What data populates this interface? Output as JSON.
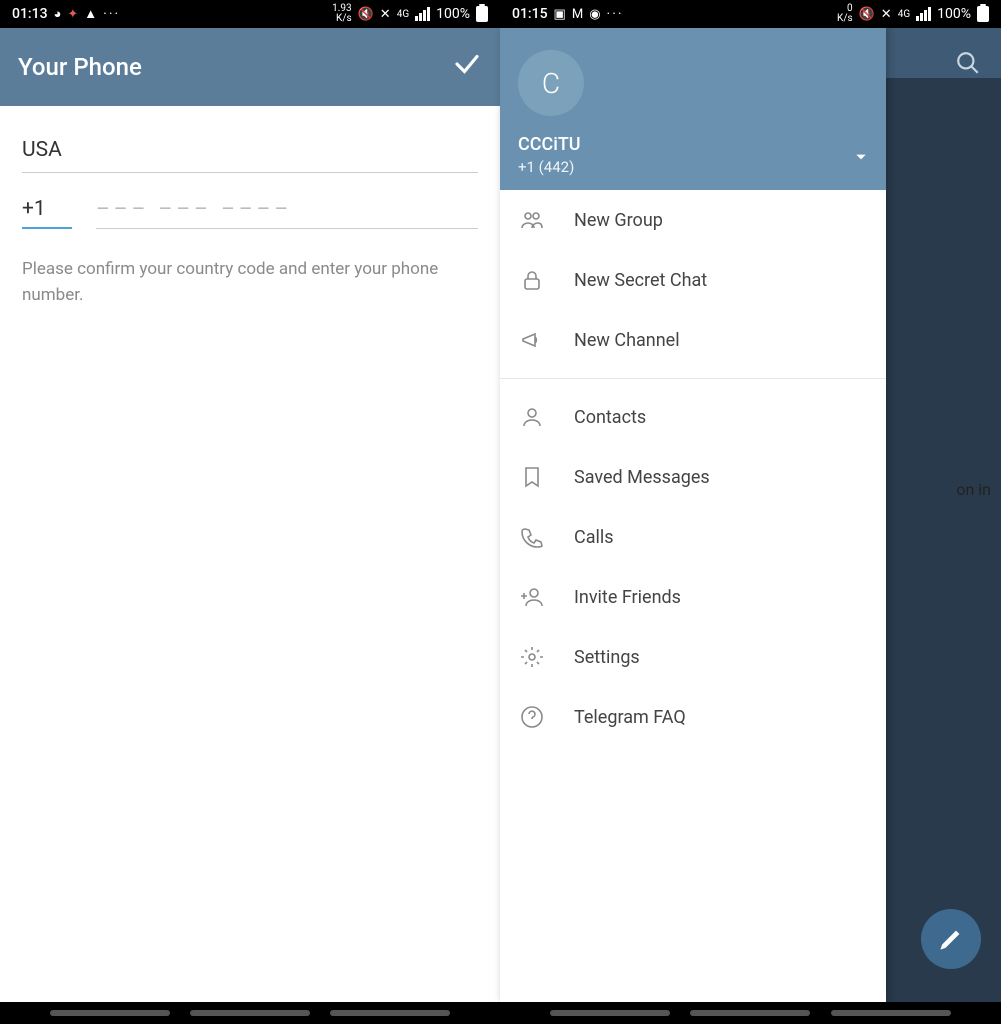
{
  "left": {
    "status": {
      "time": "01:13",
      "kbs": "1.93\nK/s",
      "net": "4G",
      "battery": "100%"
    },
    "header": {
      "title": "Your Phone"
    },
    "login": {
      "country": "USA",
      "code": "+1",
      "placeholder": "––– ––– ––––",
      "help": "Please confirm your country code and enter your phone number."
    }
  },
  "right": {
    "status": {
      "time": "01:15",
      "kbs": "0\nK/s",
      "net": "4G",
      "battery": "100%"
    },
    "bg_fragment": "on in",
    "drawer": {
      "avatar_initial": "C",
      "user_name": "CCCiTU",
      "user_phone": "+1 (442)",
      "menu_a": [
        {
          "key": "new-group",
          "label": "New Group"
        },
        {
          "key": "new-secret",
          "label": "New Secret Chat"
        },
        {
          "key": "new-channel",
          "label": "New Channel"
        }
      ],
      "menu_b": [
        {
          "key": "contacts",
          "label": "Contacts"
        },
        {
          "key": "saved",
          "label": "Saved Messages"
        },
        {
          "key": "calls",
          "label": "Calls"
        },
        {
          "key": "invite",
          "label": "Invite Friends"
        },
        {
          "key": "settings",
          "label": "Settings"
        },
        {
          "key": "faq",
          "label": "Telegram FAQ"
        }
      ]
    }
  }
}
